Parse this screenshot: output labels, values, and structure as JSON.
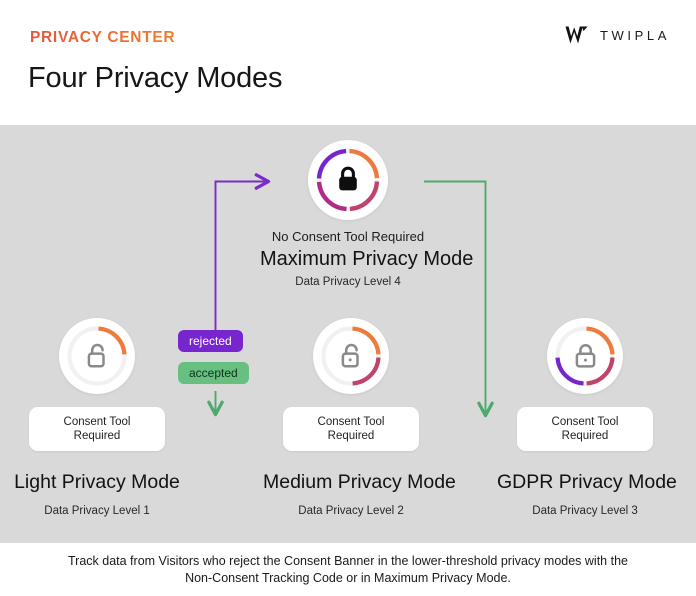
{
  "header": {
    "eyebrow": "PRIVACY CENTER",
    "title": "Four Privacy Modes",
    "logo_word": "TWIPLA",
    "logo_mark_name": "twipla-w-logo-icon"
  },
  "colors": {
    "eyebrow_gradient_start": "#E1583F",
    "eyebrow_gradient_end": "#F07F2E",
    "stage_background": "#D9D9D9",
    "page_background": "#FFFFFF",
    "ring_orange": "#EE7A3C",
    "ring_crimson": "#C0446A",
    "ring_magenta": "#B02A86",
    "ring_purple": "#7726CF",
    "ring_track": "#F0F0F0",
    "rejected_badge": "#7726CF",
    "accepted_badge": "#67BF80",
    "rejected_arrow": "#7B2BC9",
    "accepted_arrow": "#4FA96B",
    "lock_dark": "#0E0E0E",
    "lock_gray": "#8A8A8A"
  },
  "nodes": {
    "maximum": {
      "sub": "No Consent Tool Required",
      "name": "Maximum Privacy Mode",
      "level": "Data Privacy Level 4",
      "lock_icon": "lock-closed-icon",
      "segments": 4,
      "lock_color": "#0E0E0E"
    },
    "light": {
      "pill": "Consent Tool Required",
      "name": "Light Privacy Mode",
      "level": "Data Privacy Level 1",
      "lock_icon": "lock-open-icon",
      "segments": 1,
      "lock_color": "#8A8A8A"
    },
    "medium": {
      "pill": "Consent Tool Required",
      "name": "Medium Privacy Mode",
      "level": "Data Privacy Level 2",
      "lock_icon": "lock-open-icon",
      "segments": 2,
      "lock_color": "#8A8A8A"
    },
    "gdpr": {
      "pill": "Consent Tool Required",
      "name": "GDPR Privacy Mode",
      "level": "Data Privacy Level 3",
      "lock_icon": "lock-closed-icon",
      "segments": 3,
      "lock_color": "#8A8A8A"
    }
  },
  "flow": {
    "rejected_label": "rejected",
    "accepted_label": "accepted",
    "rejected_arrow_name": "rejected-flow-arrow",
    "accepted_arrow_name": "accepted-flow-arrow",
    "maximum_to_gdpr_arrow_name": "maximum-to-gdpr-arrow"
  },
  "caption": {
    "text": "Track data from Visitors who reject the Consent Banner in the lower-threshold privacy modes with the Non-Consent Tracking Code or in Maximum Privacy Mode."
  }
}
